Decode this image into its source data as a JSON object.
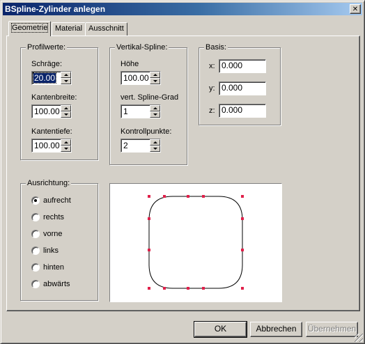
{
  "window": {
    "title": "BSpline-Zylinder anlegen",
    "close_glyph": "✕"
  },
  "tabs": [
    {
      "label": "Geometrie",
      "active": true
    },
    {
      "label": "Material",
      "active": false
    },
    {
      "label": "Ausschnitt",
      "active": false
    }
  ],
  "profilwerte": {
    "title": "Profilwerte:",
    "schraege": {
      "label": "Schräge:",
      "value": "20.00",
      "selected": true
    },
    "kantenbreite": {
      "label": "Kantenbreite:",
      "value": "100.00"
    },
    "kantentiefe": {
      "label": "Kantentiefe:",
      "value": "100.00"
    }
  },
  "vertikal_spline": {
    "title": "Vertikal-Spline:",
    "hoehe": {
      "label": "Höhe",
      "value": "100.00"
    },
    "grad": {
      "label": "vert. Spline-Grad",
      "value": "1"
    },
    "kontrollpunkte": {
      "label": "Kontrollpunkte:",
      "value": "2"
    }
  },
  "basis": {
    "title": "Basis:",
    "x": {
      "label": "x:",
      "value": "0.000"
    },
    "y": {
      "label": "y:",
      "value": "0.000"
    },
    "z": {
      "label": "z:",
      "value": "0.000"
    }
  },
  "ausrichtung": {
    "title": "Ausrichtung:",
    "options": [
      {
        "label": "aufrecht",
        "checked": true
      },
      {
        "label": "rechts",
        "checked": false
      },
      {
        "label": "vorne",
        "checked": false
      },
      {
        "label": "links",
        "checked": false
      },
      {
        "label": "hinten",
        "checked": false
      },
      {
        "label": "abwärts",
        "checked": false
      }
    ]
  },
  "preview": {
    "curve_color": "#000000",
    "control_point_color": "#e0204a"
  },
  "buttons": {
    "ok": "OK",
    "cancel": "Abbrechen",
    "apply": "Übernehmen"
  }
}
